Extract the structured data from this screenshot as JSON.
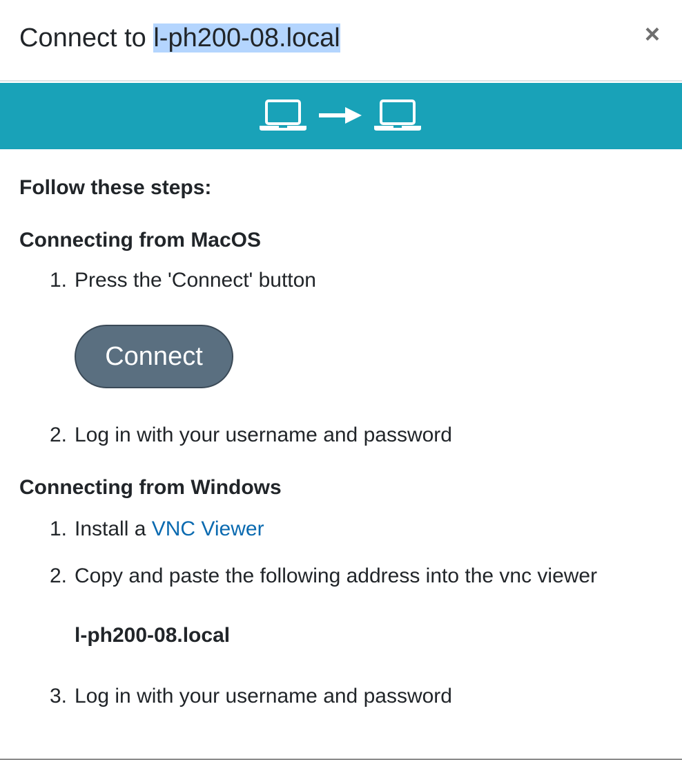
{
  "dialog": {
    "title_prefix": "Connect to ",
    "hostname": "l-ph200-08.local",
    "close_symbol": "×"
  },
  "banner": {
    "icons": [
      "laptop-icon",
      "arrow-right-icon",
      "laptop-icon"
    ],
    "color": "#19a2b8"
  },
  "content": {
    "steps_heading": "Follow these steps:",
    "mac": {
      "title": "Connecting from MacOS",
      "step1_num": "1.",
      "step1_text": "Press the 'Connect' button",
      "connect_label": "Connect",
      "step2_num": "2.",
      "step2_text": "Log in with your username and password"
    },
    "windows": {
      "title": "Connecting from Windows",
      "step1_num": "1.",
      "step1_text": "Install a ",
      "step1_link": "VNC Viewer",
      "step2_num": "2.",
      "step2_text": "Copy and paste the following address into the vnc viewer",
      "address": "l-ph200-08.local",
      "step3_num": "3.",
      "step3_text": "Log in with your username and password"
    }
  },
  "colors": {
    "button_bg": "#5a6f80",
    "link": "#0a6ab0",
    "highlight": "#b4d5fe"
  }
}
